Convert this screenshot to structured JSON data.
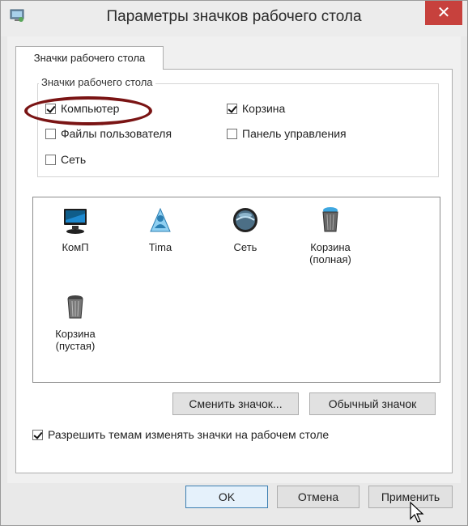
{
  "window": {
    "title": "Параметры значков рабочего стола",
    "close_label": "✕"
  },
  "tab": {
    "label": "Значки рабочего стола"
  },
  "group": {
    "legend": "Значки рабочего стола",
    "checkboxes": [
      {
        "label": "Компьютер",
        "checked": true
      },
      {
        "label": "Корзина",
        "checked": true
      },
      {
        "label": "Файлы пользователя",
        "checked": false
      },
      {
        "label": "Панель управления",
        "checked": false
      },
      {
        "label": "Сеть",
        "checked": false
      }
    ]
  },
  "icons": [
    {
      "label": "КомП",
      "icon": "computer-icon"
    },
    {
      "label": "Tima",
      "icon": "user-folder-icon"
    },
    {
      "label": "Сеть",
      "icon": "network-icon"
    },
    {
      "label": "Корзина (полная)",
      "icon": "recycle-bin-full-icon"
    },
    {
      "label": "Корзина (пустая)",
      "icon": "recycle-bin-empty-icon"
    }
  ],
  "buttons": {
    "change_icon": "Сменить значок...",
    "default_icon": "Обычный значок",
    "ok": "OK",
    "cancel": "Отмена",
    "apply": "Применить"
  },
  "allow_themes": {
    "label": "Разрешить темам изменять значки на рабочем столе",
    "checked": true
  },
  "colors": {
    "close_button": "#c7413d",
    "highlight_ring": "#7a1414",
    "default_button_border": "#3c7fb1"
  }
}
